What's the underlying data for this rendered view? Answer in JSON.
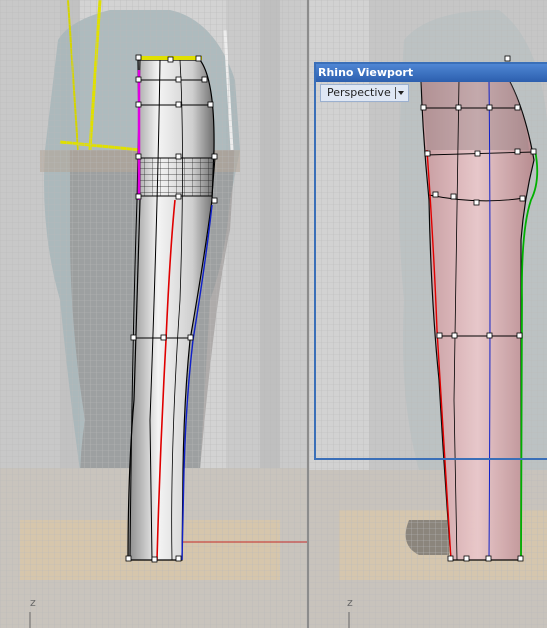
{
  "viewports": {
    "left": {
      "axis_label": "z"
    },
    "right": {
      "axis_label": "z"
    }
  },
  "rhino_window": {
    "title": "Rhino Viewport",
    "view_name": "Perspective"
  },
  "colors": {
    "grid": "#bdbdbd",
    "curve_red": "#e00000",
    "curve_blue": "#1020c8",
    "curve_green": "#00b000",
    "curve_magenta": "#e000e0",
    "curve_yellow": "#e0e000",
    "window_border": "#3a6fb8"
  }
}
